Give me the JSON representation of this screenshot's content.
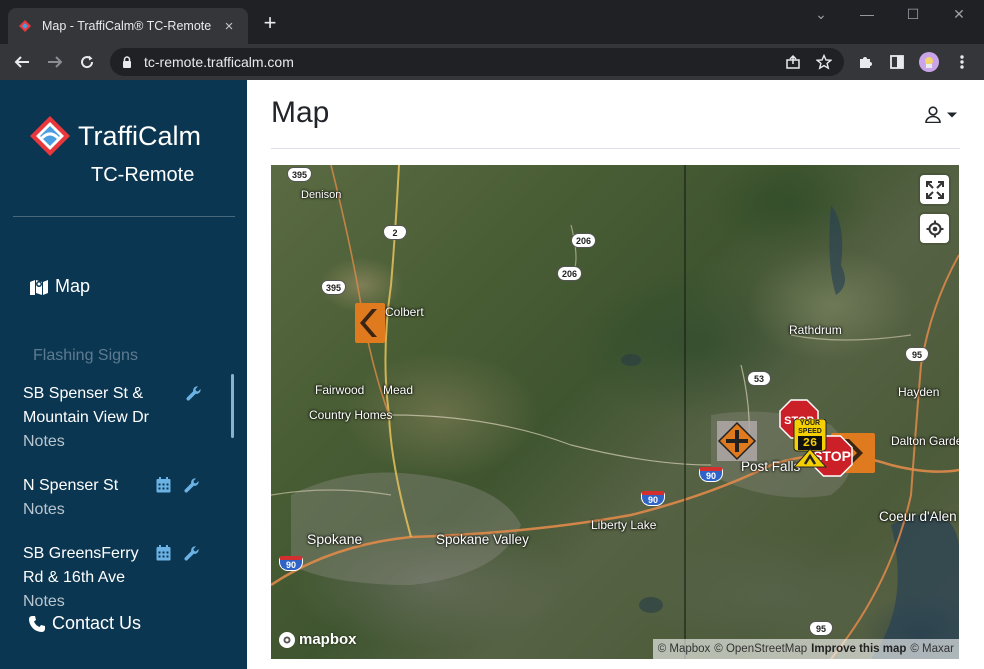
{
  "browser": {
    "tab_title": "Map - TraffiCalm® TC-Remote",
    "tab_close": "×",
    "new_tab": "+",
    "url": "tc-remote.trafficalm.com",
    "window_controls": {
      "minimize": "—",
      "maximize": "☐",
      "close": "✕"
    }
  },
  "sidebar": {
    "brand": "TraffiCalm",
    "product": "TC-Remote",
    "nav_map": "Map",
    "section_title": "Flashing Signs",
    "signs": [
      {
        "name_line1": "SB Spenser St &",
        "name_line2": "Mountain View Dr",
        "notes": "Notes",
        "has_calendar": false
      },
      {
        "name_line1": "N Spenser St",
        "name_line2": "",
        "notes": "Notes",
        "has_calendar": true
      },
      {
        "name_line1": "SB GreensFerry",
        "name_line2": "Rd & 16th Ave",
        "notes": "Notes",
        "has_calendar": true
      }
    ],
    "contact": "Contact Us"
  },
  "main": {
    "title": "Map"
  },
  "map": {
    "labels": {
      "denison": "Denison",
      "colbert": "Colbert",
      "fairwood": "Fairwood",
      "mead": "Mead",
      "country_homes": "Country Homes",
      "rathdrum": "Rathdrum",
      "hayden": "Hayden",
      "dalton_gardens": "Dalton Garde",
      "post_falls": "Post Falls",
      "coeur_dalene": "Coeur d'Alen",
      "spokane": "Spokane",
      "spokane_valley": "Spokane Valley",
      "liberty_lake": "Liberty Lake"
    },
    "shields": {
      "s395_top": "395",
      "s2": "2",
      "s206_a": "206",
      "s206_b": "206",
      "s395_mid": "395",
      "s53": "53",
      "s95_top": "95",
      "s90_a": "90",
      "s90_b": "90",
      "s90_c": "90",
      "s95_bottom": "95"
    },
    "markers": {
      "speed_top": "YOUR",
      "speed_mid": "SPEED",
      "speed_value": "26",
      "stop_text": "STOP"
    },
    "logo": "mapbox",
    "attribution": {
      "mapbox": "© Mapbox",
      "osm": "© OpenStreetMap",
      "improve": "Improve this map",
      "maxar": "© Maxar"
    }
  },
  "colors": {
    "sidebar_bg": "#0b3651",
    "brand_red": "#e8383d",
    "brand_blue": "#4a9fe0",
    "chevron_orange": "#e07a1f",
    "stop_red": "#cc2028",
    "speed_yellow": "#f5d000"
  }
}
